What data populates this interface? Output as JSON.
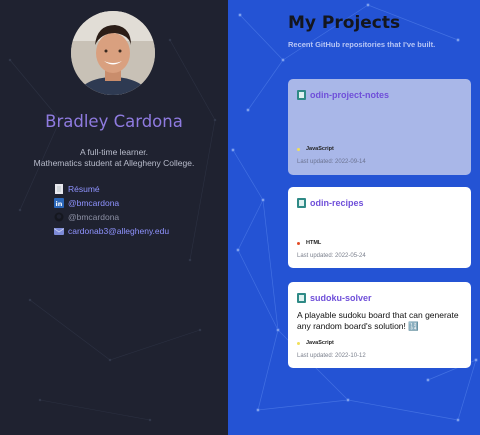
{
  "profile": {
    "name": "Bradley Cardona",
    "bio_line1": "A full-time learner.",
    "bio_line2": "Mathematics student at Allegheny College."
  },
  "links": [
    {
      "icon": "document-icon",
      "label": "Résumé",
      "color": "#8f93ff"
    },
    {
      "icon": "linkedin-icon",
      "label": "@bmcardona",
      "color": "#8f93ff"
    },
    {
      "icon": "github-icon",
      "label": "@bmcardona",
      "color": "#8c90a4"
    },
    {
      "icon": "email-icon",
      "label": "cardonab3@allegheny.edu",
      "color": "#8f93ff"
    }
  ],
  "projects": {
    "title": "My Projects",
    "subtitle": "Recent GitHub repositories that I've built.",
    "repos": [
      {
        "name": "odin-project-notes",
        "description": "",
        "language": "JavaScript",
        "language_color": "#f1e05a",
        "updated": "Last updated: 2022-09-14"
      },
      {
        "name": "odin-recipes",
        "description": "",
        "language": "HTML",
        "language_color": "#e34c26",
        "updated": "Last updated: 2022-05-24"
      },
      {
        "name": "sudoku-solver",
        "description": "A playable sudoku board that can generate any random board's solution! 🔢",
        "language": "JavaScript",
        "language_color": "#f1e05a",
        "updated": "Last updated: 2022-10-12"
      }
    ]
  },
  "colors": {
    "left_bg": "#1f2230",
    "right_bg": "#2453d4",
    "accent": "#8f7be0"
  }
}
